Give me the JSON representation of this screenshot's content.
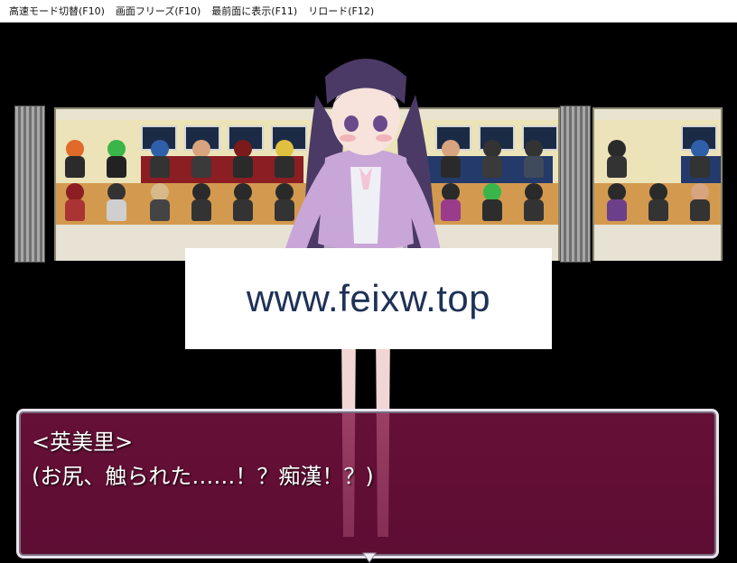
{
  "menu": [
    {
      "label": "高速モード切替(F10)"
    },
    {
      "label": "画面フリーズ(F10)"
    },
    {
      "label": "最前面に表示(F11)"
    },
    {
      "label": "リロード(F12)"
    }
  ],
  "watermark": "www.feixw.top",
  "dialogue": {
    "speaker": "<英美里>",
    "text": "(お尻、触られた……！？痴漢！？)"
  },
  "colors": {
    "message_window": "#7a1450",
    "heroine_dress": "#c9a6d8",
    "heroine_hair": "#4b3a66"
  }
}
